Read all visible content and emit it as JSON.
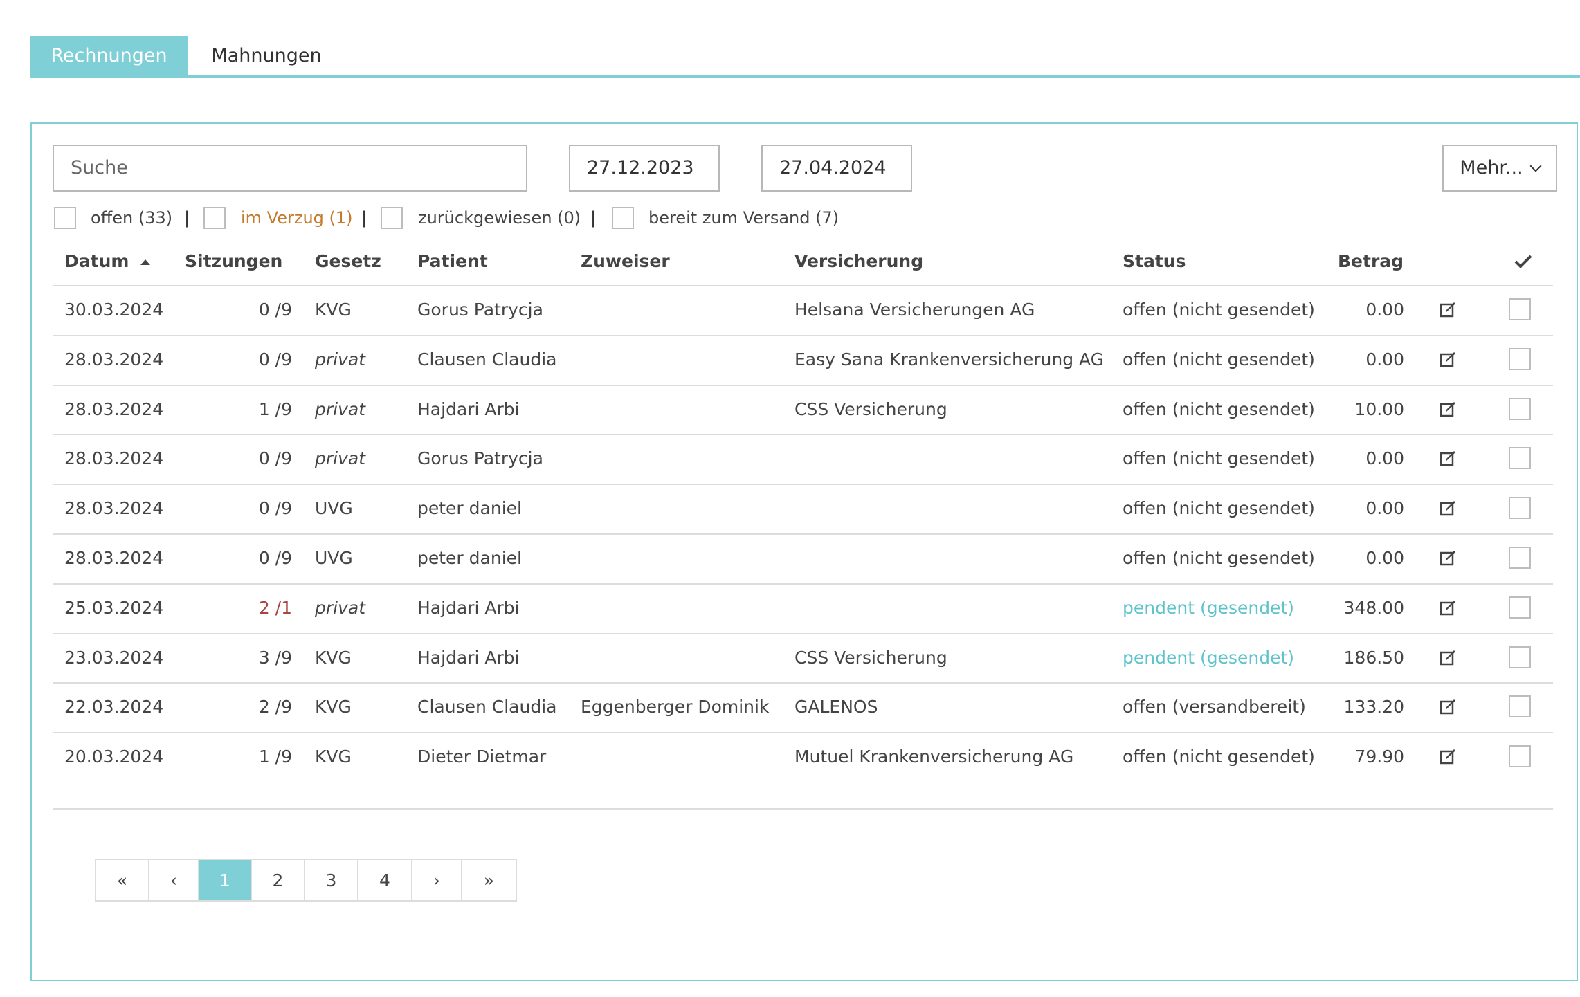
{
  "tabs": {
    "active": "Rechnungen",
    "other": "Mahnungen"
  },
  "search": {
    "placeholder": "Suche"
  },
  "dates": {
    "from": "27.12.2023",
    "to": "27.04.2024"
  },
  "more_button": "Mehr...",
  "filters": [
    {
      "label": "offen (33)",
      "color": "#444444"
    },
    {
      "label": "im Verzug (1)",
      "color": "#c47a2c"
    },
    {
      "label": "zurückgewiesen (0)",
      "color": "#444444"
    },
    {
      "label": "bereit zum Versand (7)",
      "color": "#444444"
    }
  ],
  "separator": "|",
  "columns": {
    "datum": "Datum",
    "sort_icon": "sort-up-icon",
    "sitzungen": "Sitzungen",
    "gesetz": "Gesetz",
    "patient": "Patient",
    "zuweiser": "Zuweiser",
    "versicherung": "Versicherung",
    "status": "Status",
    "betrag": "Betrag",
    "check_icon": "checkmark-icon"
  },
  "rows": [
    {
      "datum": "30.03.2024",
      "sitzungen": "0 /9",
      "gesetz": "KVG",
      "patient": "Gorus Patrycja",
      "zuweiser": "",
      "versicherung": "Helsana Versicherungen AG",
      "status": "offen (nicht gesendet)",
      "betrag": "0.00"
    },
    {
      "datum": "28.03.2024",
      "sitzungen": "0 /9",
      "gesetz": "privat",
      "patient": "Clausen Claudia",
      "zuweiser": "",
      "versicherung": "Easy Sana Krankenversicherung AG",
      "status": "offen (nicht gesendet)",
      "betrag": "0.00"
    },
    {
      "datum": "28.03.2024",
      "sitzungen": "1 /9",
      "gesetz": "privat",
      "patient": "Hajdari Arbi",
      "zuweiser": "",
      "versicherung": "CSS Versicherung",
      "status": "offen (nicht gesendet)",
      "betrag": "10.00"
    },
    {
      "datum": "28.03.2024",
      "sitzungen": "0 /9",
      "gesetz": "privat",
      "patient": "Gorus Patrycja",
      "zuweiser": "",
      "versicherung": "",
      "status": "offen (nicht gesendet)",
      "betrag": "0.00"
    },
    {
      "datum": "28.03.2024",
      "sitzungen": "0 /9",
      "gesetz": "UVG",
      "patient": "peter daniel",
      "zuweiser": "",
      "versicherung": "",
      "status": "offen (nicht gesendet)",
      "betrag": "0.00"
    },
    {
      "datum": "28.03.2024",
      "sitzungen": "0 /9",
      "gesetz": "UVG",
      "patient": "peter daniel",
      "zuweiser": "",
      "versicherung": "",
      "status": "offen (nicht gesendet)",
      "betrag": "0.00"
    },
    {
      "datum": "25.03.2024",
      "sitzungen": "2 /1",
      "gesetz": "privat",
      "patient": "Hajdari Arbi",
      "zuweiser": "",
      "versicherung": "",
      "status": "pendent (gesendet)",
      "betrag": "348.00"
    },
    {
      "datum": "23.03.2024",
      "sitzungen": "3 /9",
      "gesetz": "KVG",
      "patient": "Hajdari Arbi",
      "zuweiser": "",
      "versicherung": "CSS Versicherung",
      "status": "pendent (gesendet)",
      "betrag": "186.50"
    },
    {
      "datum": "22.03.2024",
      "sitzungen": "2 /9",
      "gesetz": "KVG",
      "patient": "Clausen Claudia",
      "zuweiser": "Eggenberger Dominik",
      "versicherung": "GALENOS",
      "status": "offen (versandbereit)",
      "betrag": "133.20"
    },
    {
      "datum": "20.03.2024",
      "sitzungen": "1 /9",
      "gesetz": "KVG",
      "patient": "Dieter Dietmar",
      "zuweiser": "",
      "versicherung": "Mutuel Krankenversicherung AG",
      "status": "offen (nicht gesendet)",
      "betrag": "79.90"
    }
  ],
  "row_icon": "edit-icon",
  "pagination": {
    "items": [
      "«",
      "‹",
      "1",
      "2",
      "3",
      "4",
      "›",
      "»"
    ],
    "current": "1"
  },
  "colors": {
    "accent": "#7fcfd6",
    "pending": "#5fc3cb",
    "warning": "#c47a2c",
    "session_warning": "#a94442"
  }
}
